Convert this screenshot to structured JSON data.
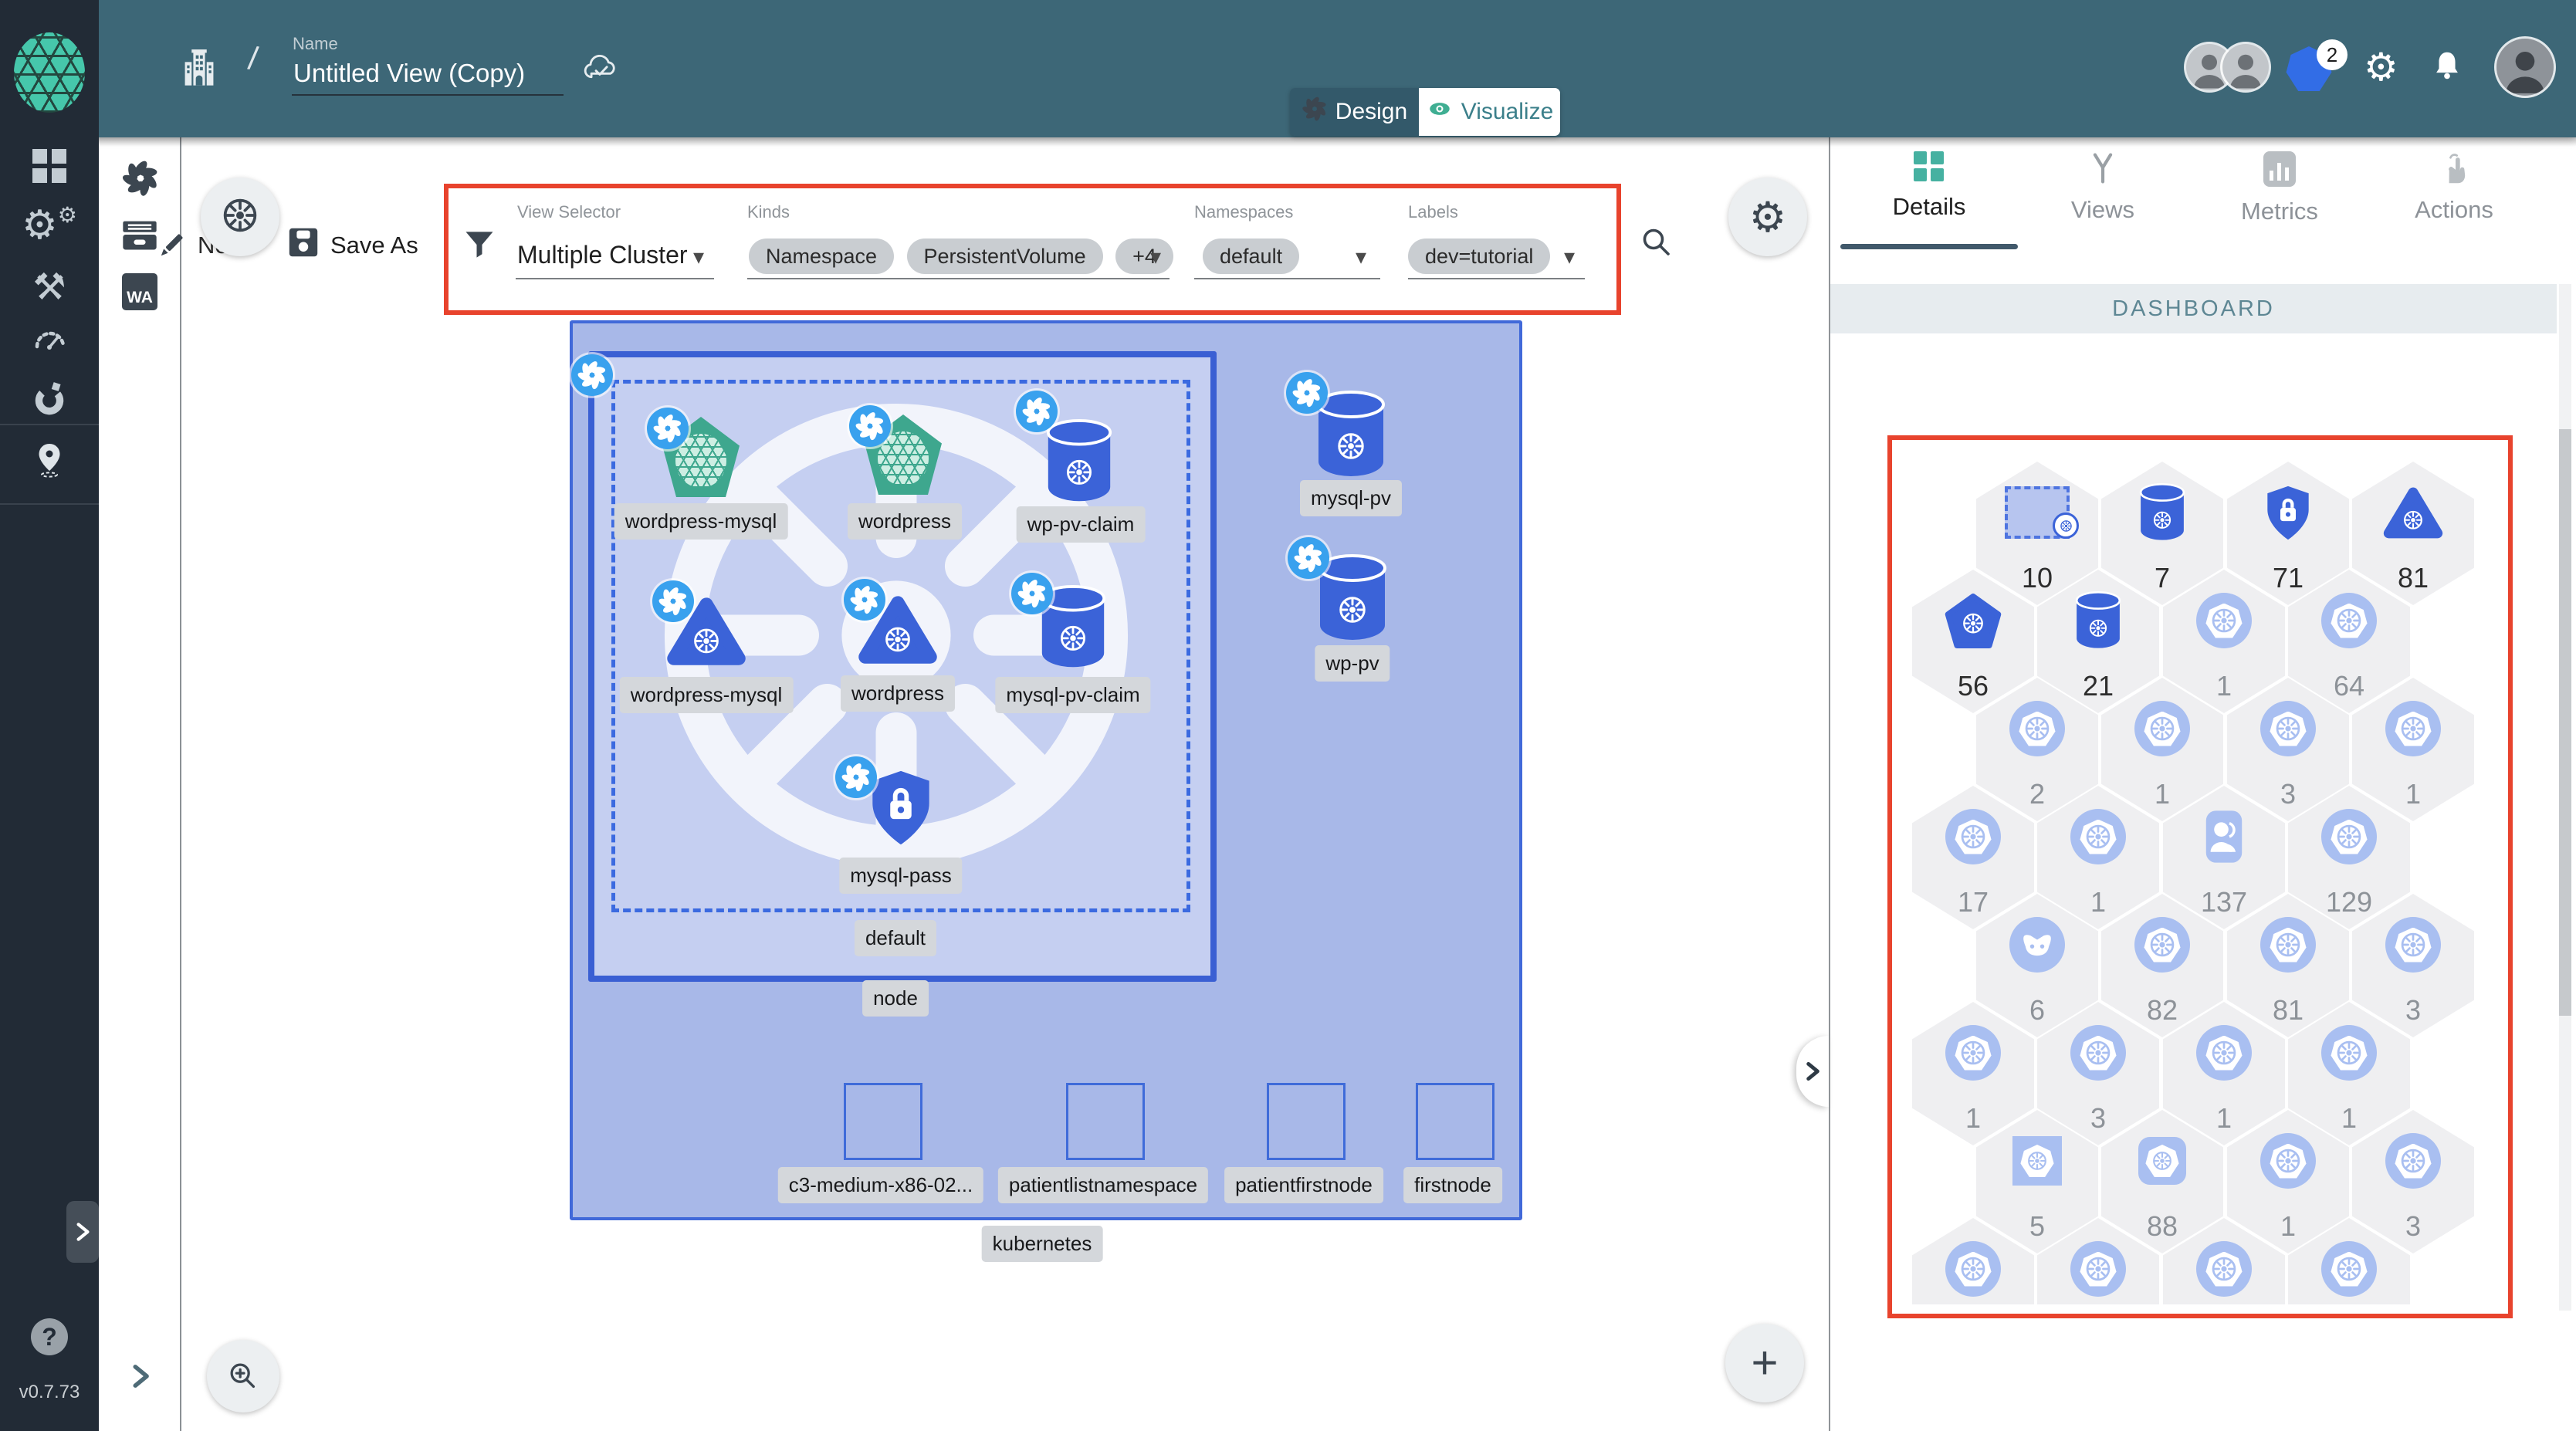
{
  "header": {
    "name_label": "Name",
    "name_value": "Untitled View (Copy)",
    "breadcrumb_slash": "/",
    "mode_toggle": {
      "design": "Design",
      "visualize": "Visualize"
    },
    "k8s_context_badge": "2"
  },
  "toolbar": {
    "new_label": "New",
    "save_as_label": "Save As",
    "filters": {
      "view_selector": {
        "label": "View Selector",
        "value": "Multiple Cluster"
      },
      "kinds": {
        "label": "Kinds",
        "chips": [
          "Namespace",
          "PersistentVolume",
          "+4"
        ]
      },
      "namespaces": {
        "label": "Namespaces",
        "value": "default"
      },
      "labels": {
        "label": "Labels",
        "value": "dev=tutorial"
      }
    }
  },
  "canvas": {
    "cluster_label": "kubernetes",
    "node_label": "node",
    "namespace_label": "default",
    "nodes": [
      {
        "label": "wordpress-mysql",
        "kind": "application"
      },
      {
        "label": "wordpress",
        "kind": "application"
      },
      {
        "label": "wp-pv-claim",
        "kind": "persistent-volume-claim"
      },
      {
        "label": "wordpress-mysql",
        "kind": "deployment"
      },
      {
        "label": "wordpress",
        "kind": "deployment"
      },
      {
        "label": "mysql-pv-claim",
        "kind": "persistent-volume-claim"
      },
      {
        "label": "mysql-pass",
        "kind": "secret"
      },
      {
        "label": "mysql-pv",
        "kind": "persistent-volume"
      },
      {
        "label": "wp-pv",
        "kind": "persistent-volume"
      }
    ],
    "machine_labels": [
      "c3-medium-x86-02...",
      "patientlistnamespace",
      "patientfirstnode",
      "firstnode"
    ]
  },
  "right_panel": {
    "tabs": [
      {
        "label": "Details",
        "active": true
      },
      {
        "label": "Views",
        "active": false
      },
      {
        "label": "Metrics",
        "active": false
      },
      {
        "label": "Actions",
        "active": false
      }
    ],
    "section_title": "DASHBOARD",
    "hex_rows": [
      [
        {
          "icon": "namespace",
          "count": "10",
          "tone": "dark"
        },
        {
          "icon": "storage",
          "count": "7",
          "tone": "dark"
        },
        {
          "icon": "secret",
          "count": "71",
          "tone": "dark"
        },
        {
          "icon": "round-triangle",
          "count": "81",
          "tone": "dark"
        }
      ],
      [
        {
          "icon": "pentagon",
          "count": "56",
          "tone": "dark"
        },
        {
          "icon": "storage",
          "count": "21",
          "tone": "dark"
        },
        {
          "icon": "k8s-light",
          "count": "1",
          "tone": "gray"
        },
        {
          "icon": "k8s-light",
          "count": "64",
          "tone": "gray"
        }
      ],
      [
        {
          "icon": "k8s-light",
          "count": "2",
          "tone": "gray"
        },
        {
          "icon": "k8s-light",
          "count": "1",
          "tone": "gray"
        },
        {
          "icon": "k8s-light",
          "count": "3",
          "tone": "gray"
        },
        {
          "icon": "k8s-light",
          "count": "1",
          "tone": "gray"
        }
      ],
      [
        {
          "icon": "k8s-light",
          "count": "17",
          "tone": "gray"
        },
        {
          "icon": "k8s-light",
          "count": "1",
          "tone": "gray"
        },
        {
          "icon": "user",
          "count": "137",
          "tone": "gray"
        },
        {
          "icon": "k8s-light",
          "count": "129",
          "tone": "gray"
        }
      ],
      [
        {
          "icon": "daemon",
          "count": "6",
          "tone": "gray"
        },
        {
          "icon": "k8s-light",
          "count": "82",
          "tone": "gray"
        },
        {
          "icon": "k8s-light",
          "count": "81",
          "tone": "gray"
        },
        {
          "icon": "k8s-light",
          "count": "3",
          "tone": "gray"
        }
      ],
      [
        {
          "icon": "k8s-light",
          "count": "1",
          "tone": "gray"
        },
        {
          "icon": "k8s-light",
          "count": "3",
          "tone": "gray"
        },
        {
          "icon": "k8s-light",
          "count": "1",
          "tone": "gray"
        },
        {
          "icon": "k8s-light",
          "count": "1",
          "tone": "gray"
        }
      ],
      [
        {
          "icon": "square",
          "count": "5",
          "tone": "gray"
        },
        {
          "icon": "rounded-square",
          "count": "88",
          "tone": "gray"
        },
        {
          "icon": "k8s-light",
          "count": "1",
          "tone": "gray"
        },
        {
          "icon": "k8s-light",
          "count": "3",
          "tone": "gray"
        }
      ],
      [
        {
          "icon": "k8s-light",
          "count": "",
          "tone": "gray"
        },
        {
          "icon": "k8s-light",
          "count": "",
          "tone": "gray"
        },
        {
          "icon": "k8s-light",
          "count": "",
          "tone": "gray"
        },
        {
          "icon": "k8s-light",
          "count": "",
          "tone": "gray"
        }
      ]
    ]
  },
  "sidebar": {
    "version": "v0.7.73"
  },
  "colors": {
    "appbar_teal": "#3d6777",
    "sidebar_dark": "#222b36",
    "k8s_blue": "#326de6",
    "node_blue": "#3b63d8",
    "light_blue": "#a9bff1",
    "cluster_fill": "#a8b8e8",
    "green_pod": "#3ea78e",
    "annotation_red": "#e8432d",
    "meshery_green": "#46c7ab"
  },
  "icons": {
    "meshery-logo": "green-triangle-sphere",
    "organization": "building",
    "sync-status": "cloud-check",
    "design-mode": "swirl",
    "visualize-mode": "eye",
    "kubernetes": "ship-wheel",
    "settings": "gear",
    "notifications": "bell",
    "filter": "funnel",
    "save": "floppy-disk",
    "search": "magnifier",
    "zoom-in": "magnifier-plus",
    "add": "plus",
    "help": "question-mark",
    "location": "map-pin",
    "wasm-filters": "WA"
  }
}
